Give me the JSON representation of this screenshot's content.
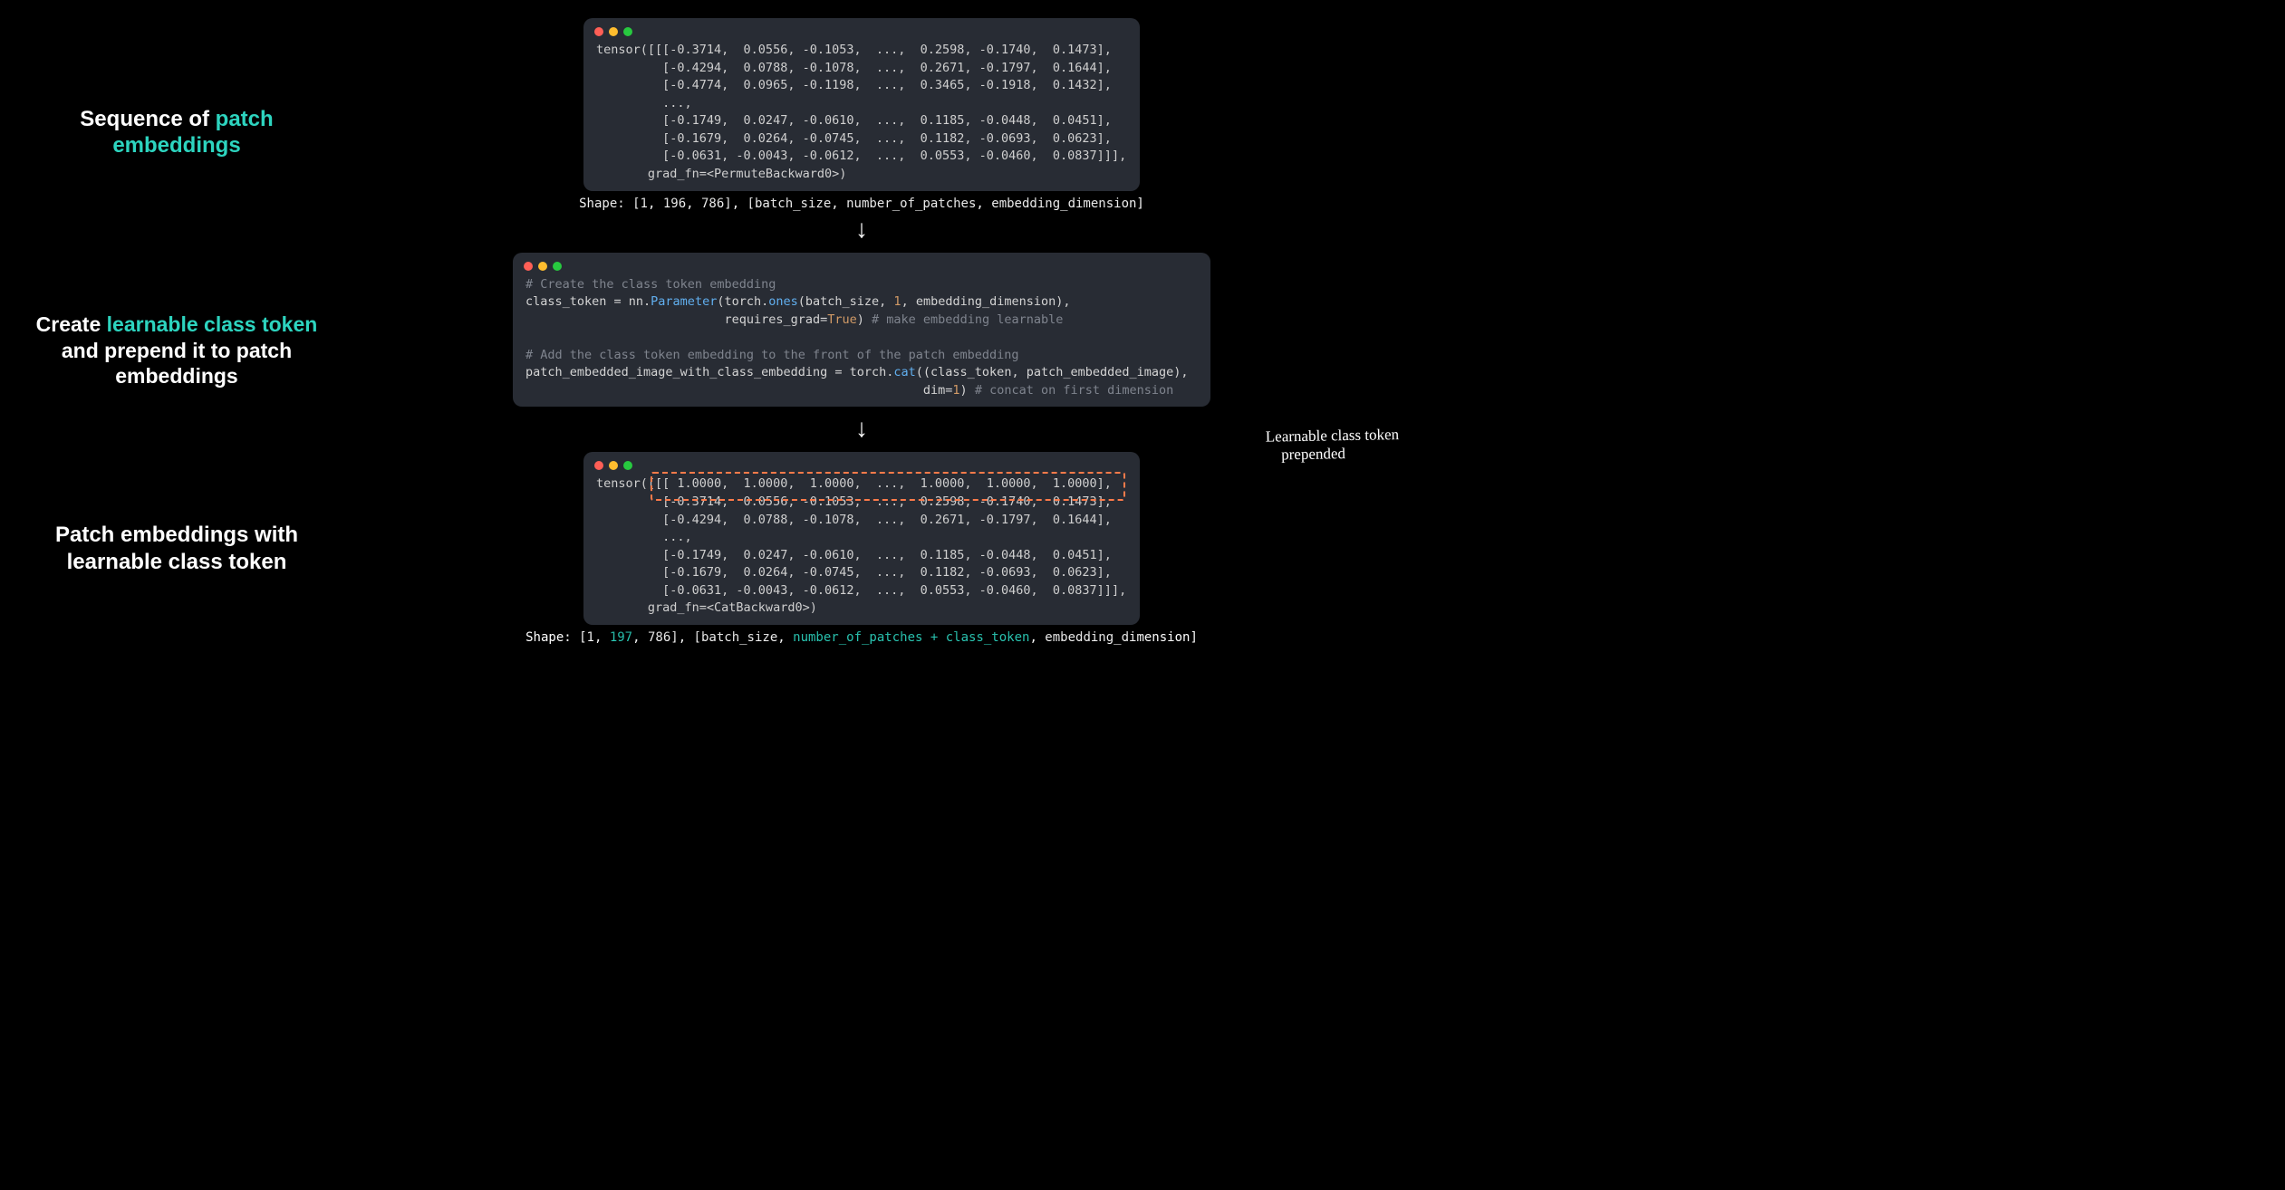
{
  "step1": {
    "label_pre": "Sequence of ",
    "label_hl": "patch embeddings",
    "tensor_lines": [
      "tensor([[[-0.3714,  0.0556, -0.1053,  ...,  0.2598, -0.1740,  0.1473],",
      "         [-0.4294,  0.0788, -0.1078,  ...,  0.2671, -0.1797,  0.1644],",
      "         [-0.4774,  0.0965, -0.1198,  ...,  0.3465, -0.1918,  0.1432],",
      "         ...,",
      "         [-0.1749,  0.0247, -0.0610,  ...,  0.1185, -0.0448,  0.0451],",
      "         [-0.1679,  0.0264, -0.0745,  ...,  0.1182, -0.0693,  0.0623],",
      "         [-0.0631, -0.0043, -0.0612,  ...,  0.0553, -0.0460,  0.0837]]],",
      "       grad_fn=<PermuteBackward0>)"
    ],
    "shape_text": "Shape: [1, 196, 786], [batch_size, number_of_patches, embedding_dimension]"
  },
  "step2": {
    "label_pre": "Create ",
    "label_hl": "learnable class token",
    "label_post": " and prepend it to patch embeddings",
    "code": {
      "c1": "# Create the class token embedding",
      "l2a": "class_token = nn.",
      "l2b": "Parameter",
      "l2c": "(torch.",
      "l2d": "ones",
      "l2e": "(batch_size, ",
      "l2f": "1",
      "l2g": ", embedding_dimension),",
      "l3a": "                           requires_grad=",
      "l3b": "True",
      "l3c": ") ",
      "l3d": "# make embedding learnable",
      "c2": "# Add the class token embedding to the front of the patch embedding",
      "l5a": "patch_embedded_image_with_class_embedding = torch.",
      "l5b": "cat",
      "l5c": "((class_token, patch_embedded_image),",
      "l6a": "                                                      dim=",
      "l6b": "1",
      "l6c": ") ",
      "l6d": "# concat on first dimension"
    }
  },
  "step3": {
    "label": "Patch embeddings with learnable class token",
    "tensor_lines": [
      "tensor([[[ 1.0000,  1.0000,  1.0000,  ...,  1.0000,  1.0000,  1.0000],",
      "         [-0.3714,  0.0556, -0.1053,  ...,  0.2598, -0.1740,  0.1473],",
      "         [-0.4294,  0.0788, -0.1078,  ...,  0.2671, -0.1797,  0.1644],",
      "         ...,",
      "         [-0.1749,  0.0247, -0.0610,  ...,  0.1185, -0.0448,  0.0451],",
      "         [-0.1679,  0.0264, -0.0745,  ...,  0.1182, -0.0693,  0.0623],",
      "         [-0.0631, -0.0043, -0.0612,  ...,  0.0553, -0.0460,  0.0837]]],",
      "       grad_fn=<CatBackward0>)"
    ],
    "shape_pre": "Shape: [1, ",
    "shape_hl1": "197",
    "shape_mid": ", 786], [batch_size, ",
    "shape_hl2": "number_of_patches + class_token",
    "shape_post": ", embedding_dimension]",
    "annotation": "Learnable class token\nprepended"
  }
}
